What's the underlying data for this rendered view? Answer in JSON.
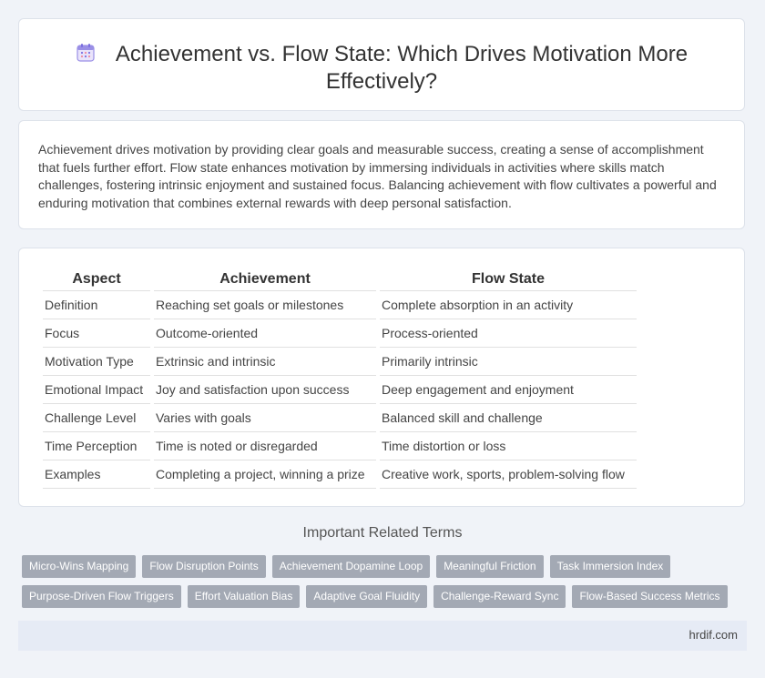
{
  "header": {
    "icon": "calendar-icon",
    "title": "Achievement vs. Flow State: Which Drives Motivation More Effectively?"
  },
  "intro": {
    "text": "Achievement drives motivation by providing clear goals and measurable success, creating a sense of accomplishment that fuels further effort. Flow state enhances motivation by immersing individuals in activities where skills match challenges, fostering intrinsic enjoyment and sustained focus. Balancing achievement with flow cultivates a powerful and enduring motivation that combines external rewards with deep personal satisfaction."
  },
  "table": {
    "headers": [
      "Aspect",
      "Achievement",
      "Flow State"
    ],
    "rows": [
      [
        "Definition",
        "Reaching set goals or milestones",
        "Complete absorption in an activity"
      ],
      [
        "Focus",
        "Outcome-oriented",
        "Process-oriented"
      ],
      [
        "Motivation Type",
        "Extrinsic and intrinsic",
        "Primarily intrinsic"
      ],
      [
        "Emotional Impact",
        "Joy and satisfaction upon success",
        "Deep engagement and enjoyment"
      ],
      [
        "Challenge Level",
        "Varies with goals",
        "Balanced skill and challenge"
      ],
      [
        "Time Perception",
        "Time is noted or disregarded",
        "Time distortion or loss"
      ],
      [
        "Examples",
        "Completing a project, winning a prize",
        "Creative work, sports, problem-solving flow"
      ]
    ]
  },
  "related": {
    "title": "Important Related Terms",
    "row1": [
      "Micro-Wins Mapping",
      "Flow Disruption Points",
      "Achievement Dopamine Loop",
      "Meaningful Friction",
      "Task Immersion Index"
    ],
    "row2": [
      "Purpose-Driven Flow Triggers",
      "Effort Valuation Bias",
      "Adaptive Goal Fluidity",
      "Challenge-Reward Sync",
      "Flow-Based Success Metrics"
    ]
  },
  "footer": {
    "site": "hrdif.com"
  },
  "colors": {
    "tag_bg": "#a3a9b4",
    "page_bg": "#f0f3f8",
    "footer_bg": "#e6ebf5",
    "icon_accent": "#7b6ee0"
  }
}
